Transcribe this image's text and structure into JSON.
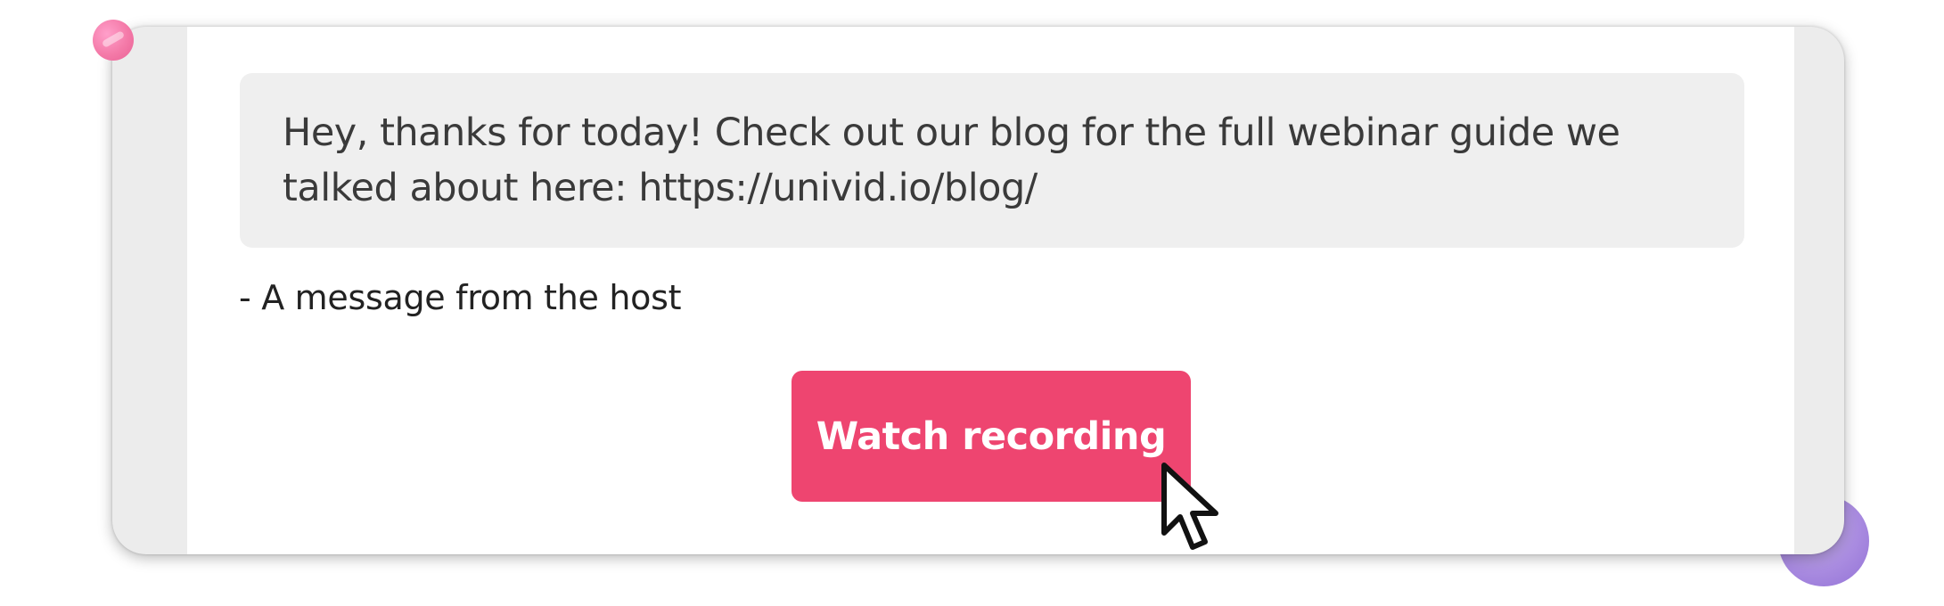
{
  "message": {
    "line1": "Hey, thanks for today! Check out our blog for the full webinar guide we",
    "line2": "talked about here: https://univid.io/blog/"
  },
  "host_note": "- A message from the host",
  "buttons": {
    "watch_recording": "Watch recording"
  },
  "colors": {
    "button_bg": "#ee4570",
    "button_text": "#ffffff",
    "card_bg": "#ececec",
    "bubble_bg": "#efefef",
    "accent_pink_dot": "#f47aa8",
    "accent_purple_dot": "#a98be0"
  },
  "icons": {
    "cursor": "mouse-pointer-arrow-icon"
  }
}
